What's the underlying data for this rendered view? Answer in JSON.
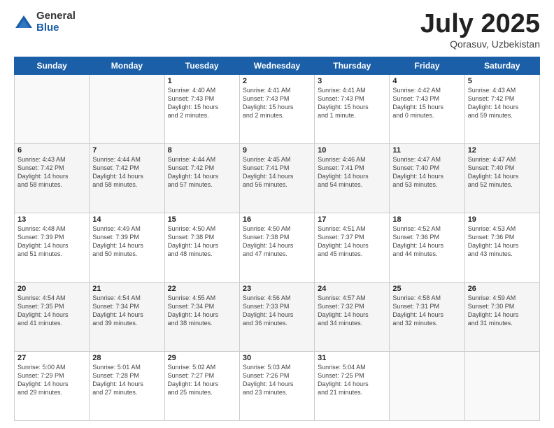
{
  "logo": {
    "general": "General",
    "blue": "Blue"
  },
  "title": {
    "month_year": "July 2025",
    "location": "Qorasuv, Uzbekistan"
  },
  "days_of_week": [
    "Sunday",
    "Monday",
    "Tuesday",
    "Wednesday",
    "Thursday",
    "Friday",
    "Saturday"
  ],
  "weeks": [
    [
      {
        "day": "",
        "info": ""
      },
      {
        "day": "",
        "info": ""
      },
      {
        "day": "1",
        "info": "Sunrise: 4:40 AM\nSunset: 7:43 PM\nDaylight: 15 hours\nand 2 minutes."
      },
      {
        "day": "2",
        "info": "Sunrise: 4:41 AM\nSunset: 7:43 PM\nDaylight: 15 hours\nand 2 minutes."
      },
      {
        "day": "3",
        "info": "Sunrise: 4:41 AM\nSunset: 7:43 PM\nDaylight: 15 hours\nand 1 minute."
      },
      {
        "day": "4",
        "info": "Sunrise: 4:42 AM\nSunset: 7:43 PM\nDaylight: 15 hours\nand 0 minutes."
      },
      {
        "day": "5",
        "info": "Sunrise: 4:43 AM\nSunset: 7:42 PM\nDaylight: 14 hours\nand 59 minutes."
      }
    ],
    [
      {
        "day": "6",
        "info": "Sunrise: 4:43 AM\nSunset: 7:42 PM\nDaylight: 14 hours\nand 58 minutes."
      },
      {
        "day": "7",
        "info": "Sunrise: 4:44 AM\nSunset: 7:42 PM\nDaylight: 14 hours\nand 58 minutes."
      },
      {
        "day": "8",
        "info": "Sunrise: 4:44 AM\nSunset: 7:42 PM\nDaylight: 14 hours\nand 57 minutes."
      },
      {
        "day": "9",
        "info": "Sunrise: 4:45 AM\nSunset: 7:41 PM\nDaylight: 14 hours\nand 56 minutes."
      },
      {
        "day": "10",
        "info": "Sunrise: 4:46 AM\nSunset: 7:41 PM\nDaylight: 14 hours\nand 54 minutes."
      },
      {
        "day": "11",
        "info": "Sunrise: 4:47 AM\nSunset: 7:40 PM\nDaylight: 14 hours\nand 53 minutes."
      },
      {
        "day": "12",
        "info": "Sunrise: 4:47 AM\nSunset: 7:40 PM\nDaylight: 14 hours\nand 52 minutes."
      }
    ],
    [
      {
        "day": "13",
        "info": "Sunrise: 4:48 AM\nSunset: 7:39 PM\nDaylight: 14 hours\nand 51 minutes."
      },
      {
        "day": "14",
        "info": "Sunrise: 4:49 AM\nSunset: 7:39 PM\nDaylight: 14 hours\nand 50 minutes."
      },
      {
        "day": "15",
        "info": "Sunrise: 4:50 AM\nSunset: 7:38 PM\nDaylight: 14 hours\nand 48 minutes."
      },
      {
        "day": "16",
        "info": "Sunrise: 4:50 AM\nSunset: 7:38 PM\nDaylight: 14 hours\nand 47 minutes."
      },
      {
        "day": "17",
        "info": "Sunrise: 4:51 AM\nSunset: 7:37 PM\nDaylight: 14 hours\nand 45 minutes."
      },
      {
        "day": "18",
        "info": "Sunrise: 4:52 AM\nSunset: 7:36 PM\nDaylight: 14 hours\nand 44 minutes."
      },
      {
        "day": "19",
        "info": "Sunrise: 4:53 AM\nSunset: 7:36 PM\nDaylight: 14 hours\nand 43 minutes."
      }
    ],
    [
      {
        "day": "20",
        "info": "Sunrise: 4:54 AM\nSunset: 7:35 PM\nDaylight: 14 hours\nand 41 minutes."
      },
      {
        "day": "21",
        "info": "Sunrise: 4:54 AM\nSunset: 7:34 PM\nDaylight: 14 hours\nand 39 minutes."
      },
      {
        "day": "22",
        "info": "Sunrise: 4:55 AM\nSunset: 7:34 PM\nDaylight: 14 hours\nand 38 minutes."
      },
      {
        "day": "23",
        "info": "Sunrise: 4:56 AM\nSunset: 7:33 PM\nDaylight: 14 hours\nand 36 minutes."
      },
      {
        "day": "24",
        "info": "Sunrise: 4:57 AM\nSunset: 7:32 PM\nDaylight: 14 hours\nand 34 minutes."
      },
      {
        "day": "25",
        "info": "Sunrise: 4:58 AM\nSunset: 7:31 PM\nDaylight: 14 hours\nand 32 minutes."
      },
      {
        "day": "26",
        "info": "Sunrise: 4:59 AM\nSunset: 7:30 PM\nDaylight: 14 hours\nand 31 minutes."
      }
    ],
    [
      {
        "day": "27",
        "info": "Sunrise: 5:00 AM\nSunset: 7:29 PM\nDaylight: 14 hours\nand 29 minutes."
      },
      {
        "day": "28",
        "info": "Sunrise: 5:01 AM\nSunset: 7:28 PM\nDaylight: 14 hours\nand 27 minutes."
      },
      {
        "day": "29",
        "info": "Sunrise: 5:02 AM\nSunset: 7:27 PM\nDaylight: 14 hours\nand 25 minutes."
      },
      {
        "day": "30",
        "info": "Sunrise: 5:03 AM\nSunset: 7:26 PM\nDaylight: 14 hours\nand 23 minutes."
      },
      {
        "day": "31",
        "info": "Sunrise: 5:04 AM\nSunset: 7:25 PM\nDaylight: 14 hours\nand 21 minutes."
      },
      {
        "day": "",
        "info": ""
      },
      {
        "day": "",
        "info": ""
      }
    ]
  ]
}
